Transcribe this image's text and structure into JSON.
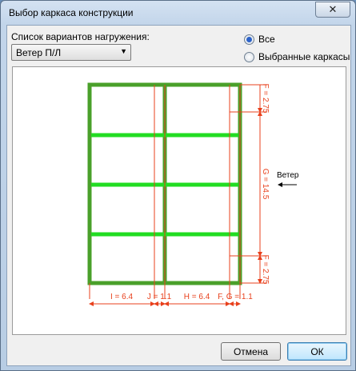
{
  "window": {
    "title": "Выбор каркаса конструкции",
    "close_symbol": "✕"
  },
  "load_cases": {
    "label": "Список вариантов нагружения:",
    "selected": "Ветер П/Л"
  },
  "radios": [
    {
      "label": "Все",
      "checked": true
    },
    {
      "label": "Выбранные каркасы",
      "checked": false
    }
  ],
  "diagram": {
    "dims_bottom": [
      "I = 6.4",
      "J = 1.1",
      "H = 6.4",
      "F, G = 1.1"
    ],
    "dims_right": [
      "F = 2.75",
      "G = 14.5",
      "F = 2.75"
    ],
    "wind_label": "Ветер",
    "colors": {
      "frame": "#4aa02a",
      "beam": "#22dd22",
      "dimension": "#e8401c"
    }
  },
  "buttons": {
    "cancel": "Отмена",
    "ok": "ОК"
  }
}
